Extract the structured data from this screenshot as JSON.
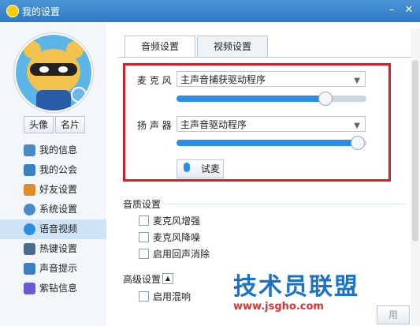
{
  "window": {
    "title": "我的设置"
  },
  "profile": {
    "avatar_btn": "头像",
    "card_btn": "名片"
  },
  "sidebar": {
    "items": [
      {
        "label": "我的信息",
        "icon": "profile-card-icon"
      },
      {
        "label": "我的公会",
        "icon": "flag-icon"
      },
      {
        "label": "好友设置",
        "icon": "friends-icon"
      },
      {
        "label": "系统设置",
        "icon": "gear-icon"
      },
      {
        "label": "语音视频",
        "icon": "voice-video-icon",
        "active": true
      },
      {
        "label": "热键设置",
        "icon": "keyboard-icon"
      },
      {
        "label": "声音提示",
        "icon": "music-note-icon"
      },
      {
        "label": "紫钻信息",
        "icon": "diamond-icon"
      }
    ]
  },
  "tabs": [
    {
      "label": "音频设置",
      "active": true
    },
    {
      "label": "视频设置",
      "active": false
    }
  ],
  "audio": {
    "mic_label": "麦 克 风",
    "mic_device": "主声音捕获驱动程序",
    "mic_level": 0.8,
    "speaker_label": "扬 声 器",
    "speaker_device": "主声音驱动程序",
    "speaker_level": 0.98,
    "test_btn": "试麦"
  },
  "quality": {
    "title": "音质设置",
    "options": [
      {
        "label": "麦克风增强",
        "checked": false
      },
      {
        "label": "麦克风降噪",
        "checked": false
      },
      {
        "label": "启用回声消除",
        "checked": false
      }
    ]
  },
  "advanced": {
    "title": "高级设置",
    "options": [
      {
        "label": "启用混响",
        "checked": false
      }
    ]
  },
  "watermark": {
    "line1": "技术员联盟",
    "line2": "www.jsgho.com"
  },
  "footer": {
    "apply": "用"
  },
  "colors": {
    "accent": "#2b8ee6",
    "highlight": "#d61f2a",
    "titlebar": "#3a86cf"
  }
}
